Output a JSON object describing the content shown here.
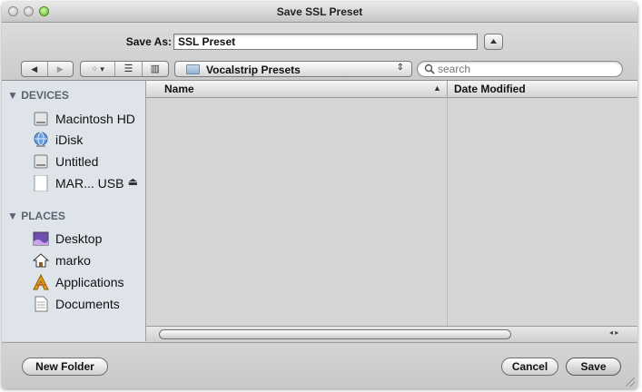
{
  "window": {
    "title": "Save SSL Preset"
  },
  "save_as": {
    "label": "Save As:",
    "value": "SSL Preset",
    "expand_icon": "disclosure-up-arrow"
  },
  "toolbar": {
    "back_glyph": "◀",
    "forward_glyph": "▶",
    "icon_view_glyph": "⁘ ▾",
    "list_view_glyph": "☰",
    "column_view_glyph": "▥",
    "location": "Vocalstrip Presets",
    "location_arrows": "⇕"
  },
  "search": {
    "placeholder": "search",
    "icon": "magnifier"
  },
  "sidebar": {
    "devices_header": "▼ DEVICES",
    "places_header": "▼ PLACES",
    "devices": [
      {
        "label": "Macintosh HD",
        "icon": "hard-drive"
      },
      {
        "label": "iDisk",
        "icon": "idisk-globe"
      },
      {
        "label": "Untitled",
        "icon": "hard-drive"
      },
      {
        "label": "MAR... USB",
        "icon": "usb-drive",
        "eject": "⏏"
      }
    ],
    "places": [
      {
        "label": "Desktop",
        "icon": "desktop"
      },
      {
        "label": "marko",
        "icon": "home"
      },
      {
        "label": "Applications",
        "icon": "applications"
      },
      {
        "label": "Documents",
        "icon": "documents"
      }
    ]
  },
  "file_list": {
    "columns": {
      "name": "Name",
      "sort_indicator": "▲",
      "date": "Date Modified"
    },
    "rows": []
  },
  "scroll": {
    "end_glyph": "◂ ▸"
  },
  "buttons": {
    "new_folder": "New Folder",
    "cancel": "Cancel",
    "save": "Save"
  }
}
